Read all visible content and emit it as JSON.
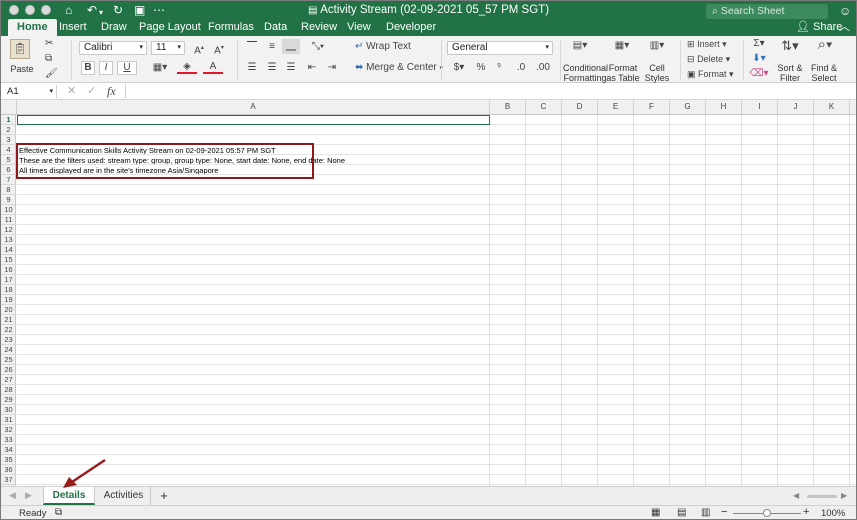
{
  "window": {
    "title": "Activity Stream (02-09-2021 05_57 PM SGT)",
    "search_placeholder": "Search Sheet",
    "share_label": "Share"
  },
  "tabs": [
    "Home",
    "Insert",
    "Draw",
    "Page Layout",
    "Formulas",
    "Data",
    "Review",
    "View",
    "Developer"
  ],
  "ribbon": {
    "paste_label": "Paste",
    "font_name": "Calibri",
    "font_size": "11",
    "wrap_text": "Wrap Text",
    "merge_center": "Merge & Center",
    "number_format": "General",
    "conditional_formatting": [
      "Conditional",
      "Formatting"
    ],
    "format_as_table": [
      "Format",
      "as Table"
    ],
    "cell_styles": [
      "Cell",
      "Styles"
    ],
    "insert": "Insert",
    "delete": "Delete",
    "format": "Format",
    "sort_filter": [
      "Sort &",
      "Filter"
    ],
    "find_select": [
      "Find &",
      "Select"
    ],
    "percent": "%",
    "currency": "$"
  },
  "formula_bar": {
    "name_box": "A1",
    "fx": "fx",
    "value": ""
  },
  "columns": [
    "A",
    "B",
    "C",
    "D",
    "E",
    "F",
    "G",
    "H",
    "I",
    "J",
    "K"
  ],
  "rows": [
    "1",
    "2",
    "3",
    "4",
    "5",
    "6",
    "7",
    "8",
    "9",
    "10",
    "11",
    "12",
    "13",
    "14",
    "15",
    "16",
    "17",
    "18",
    "19",
    "20",
    "21",
    "22",
    "23",
    "24",
    "25",
    "26",
    "27",
    "28",
    "29",
    "30",
    "31",
    "32",
    "33",
    "34",
    "35",
    "36",
    "37"
  ],
  "cells": {
    "A4": "Effective Communication Skills Activity Stream on 02-09-2021 05:57 PM SGT",
    "A5": "These are the filters used: stream type: group, group type: None, start date: None, end date: None",
    "A6": "All times displayed are in the site's timezone Asia/Singapore"
  },
  "sheets": [
    {
      "label": "Details",
      "active": true
    },
    {
      "label": "Activities",
      "active": false
    }
  ],
  "add_sheet": "+",
  "status": {
    "ready": "Ready",
    "zoom": "100%"
  },
  "colors": {
    "accent": "#217346",
    "highlight_border": "#8b1b1b",
    "arrow": "#9b1c1c"
  }
}
